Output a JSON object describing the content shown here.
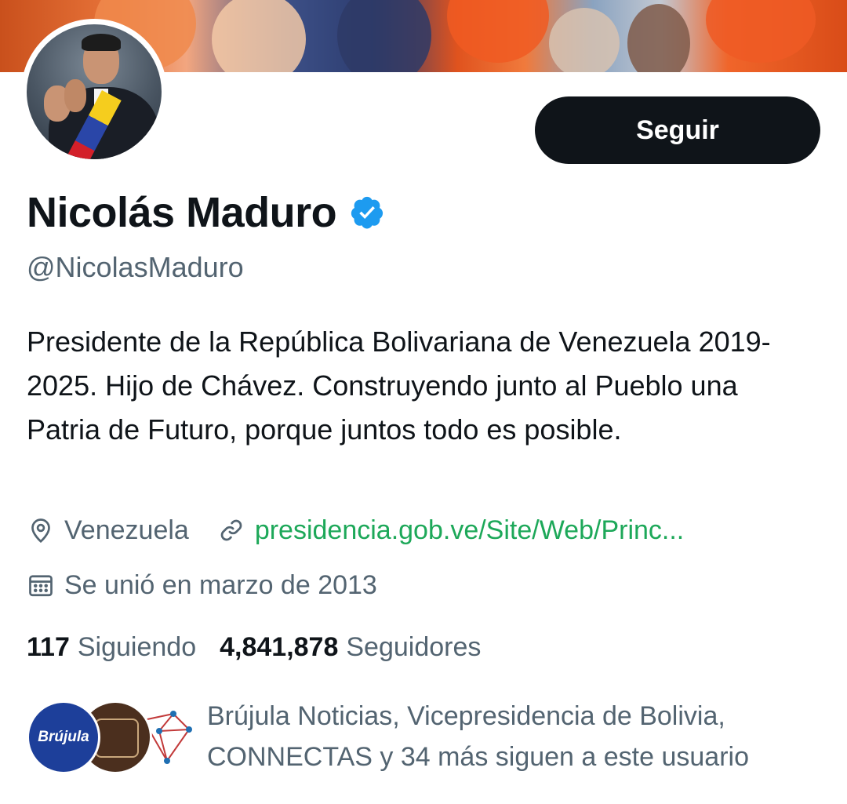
{
  "profile": {
    "name": "Nicolás Maduro",
    "handle": "@NicolasMaduro",
    "bio": "Presidente de la República Bolivariana de Venezuela 2019-2025. Hijo de Chávez. Construyendo junto al Pueblo una Patria de Futuro, porque juntos todo es posible.",
    "verified_icon": "verified-badge-icon"
  },
  "actions": {
    "follow_label": "Seguir"
  },
  "meta": {
    "location": "Venezuela",
    "location_icon": "location-pin-icon",
    "link": "presidencia.gob.ve/Site/Web/Princ...",
    "link_icon": "link-icon",
    "joined": "Se unió en marzo de 2013",
    "joined_icon": "calendar-icon"
  },
  "counts": {
    "following_number": "117",
    "following_label": "Siguiendo",
    "followers_number": "4,841,878",
    "followers_label": "Seguidores"
  },
  "followers_you_know": {
    "text": "Brújula Noticias, Vicepresidencia de Bolivia, CONNECTAS y 34 más siguen a este usuario",
    "avatar1_label": "Brújula"
  },
  "colors": {
    "accent_button": "#0f1419",
    "link": "#1da859",
    "secondary_text": "#536471",
    "verified": "#1d9bf0"
  }
}
